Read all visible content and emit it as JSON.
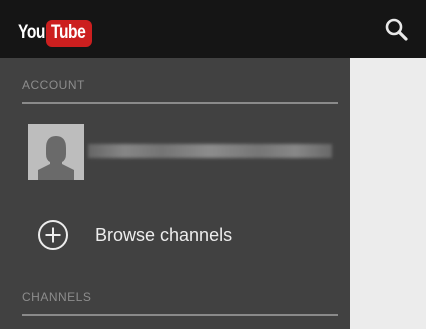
{
  "header": {
    "logo_you": "You",
    "logo_tube": "Tube",
    "search_icon": "search-icon"
  },
  "drawer": {
    "account_section": "ACCOUNT",
    "account": {
      "avatar_icon": "default-avatar-icon"
    },
    "browse_channels": {
      "label": "Browse channels",
      "icon": "plus-circle-icon"
    },
    "channels_section": "CHANNELS"
  },
  "colors": {
    "topbar": "#151515",
    "drawer": "#414141",
    "content": "#ececec",
    "brand_red": "#cc1f1f"
  }
}
